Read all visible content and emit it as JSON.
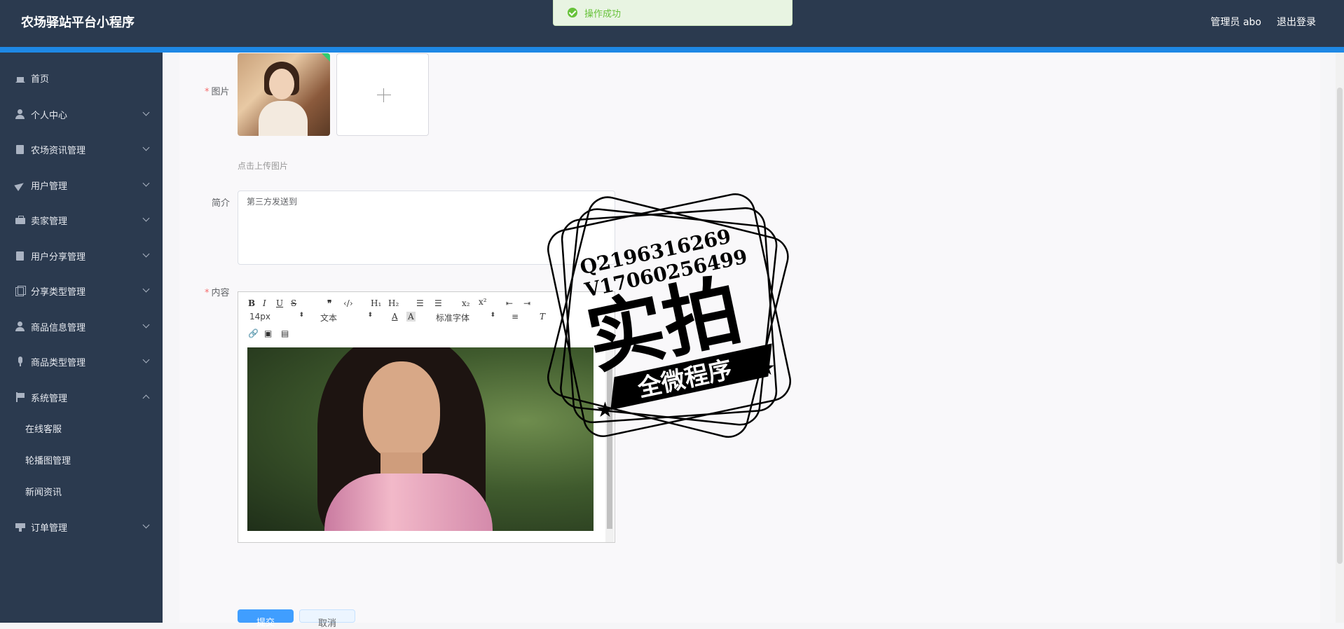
{
  "header": {
    "app_title": "农场驿站平台小程序",
    "admin_label": "管理员 abo",
    "logout_label": "退出登录"
  },
  "toast": {
    "message": "操作成功"
  },
  "sidebar": {
    "items": [
      {
        "label": "首页"
      },
      {
        "label": "个人中心"
      },
      {
        "label": "农场资讯管理"
      },
      {
        "label": "用户管理"
      },
      {
        "label": "卖家管理"
      },
      {
        "label": "用户分享管理"
      },
      {
        "label": "分享类型管理"
      },
      {
        "label": "商品信息管理"
      },
      {
        "label": "商品类型管理"
      },
      {
        "label": "系统管理"
      },
      {
        "label": "订单管理"
      }
    ],
    "system_sub": [
      {
        "label": "在线客服"
      },
      {
        "label": "轮播图管理"
      },
      {
        "label": "新闻资讯"
      }
    ]
  },
  "form": {
    "image_label": "图片",
    "upload_hint": "点击上传图片",
    "intro_label": "简介",
    "intro_value": "第三方发送到",
    "content_label": "内容",
    "font_size": "14px",
    "text_type": "文本",
    "font_family": "标准字体",
    "submit_label": "提交",
    "cancel_label": "取消"
  },
  "watermark": {
    "line1": "Q2196316269",
    "line2": "V17060256499",
    "main": "实拍",
    "banner": "全微程序"
  },
  "colors": {
    "header_bg": "#2b3a4f",
    "accent": "#1e88e5",
    "primary_button": "#409eff",
    "success": "#67c23a"
  }
}
